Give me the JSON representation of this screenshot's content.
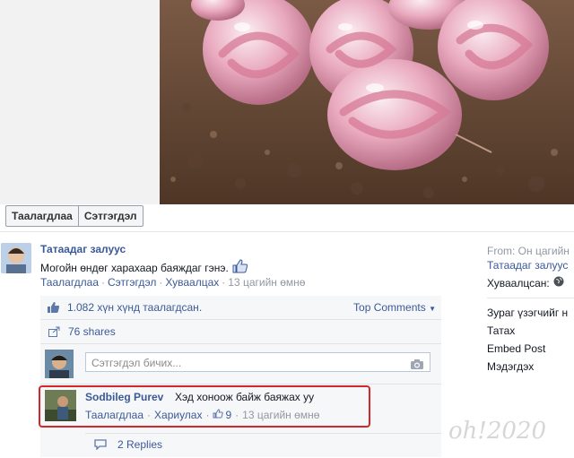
{
  "photo": {
    "alt": ""
  },
  "actions": {
    "like": "Таалагдлаа",
    "comment": "Сэтгэгдэл"
  },
  "post": {
    "author": "Татаадаг залуус",
    "caption": "Могойн өндөг харахаар баяждаг гэнэ.",
    "meta_like": "Таалагдлаа",
    "meta_comment": "Сэтгэгдэл",
    "meta_share": "Хуваалцах",
    "meta_time": "13 цагийн өмнө"
  },
  "ufi": {
    "likes_text": "1.082 хүн хүнд таалагдсан.",
    "sort_label": "Top Comments",
    "shares_text": "76 shares",
    "comment_placeholder": "Сэтгэгдэл бичих..."
  },
  "comment": {
    "author": "Sodbileg Purev",
    "text": "Хэд хоноож байж баяжах уу",
    "like": "Таалагдлаа",
    "reply": "Хариулах",
    "like_count": "9",
    "time": "13 цагийн өмнө",
    "replies": "2 Replies"
  },
  "sidebar": {
    "from": "From: Он цагийн",
    "from_name": "Татаадаг залуус",
    "shared_label": "Хуваалцсан:",
    "tag_photo": "Зураг үзэгчийг н",
    "download": "Татах",
    "embed": "Embed Post",
    "report": "Мэдэгдэх"
  },
  "watermark": "oh!2020",
  "colors": {
    "link": "#3b5998",
    "highlight": "#d4262b",
    "muted": "#9197a3"
  }
}
